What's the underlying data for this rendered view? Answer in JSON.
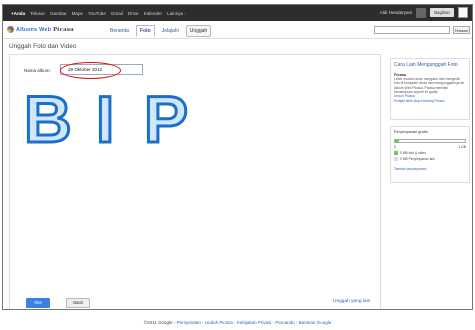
{
  "gbar": {
    "links": [
      "+Anda",
      "Telusur",
      "Gambar",
      "Maps",
      "YouTube",
      "Gmail",
      "Drive",
      "Kalender",
      "Lainnya -"
    ],
    "user": "Aldi Hendaryani",
    "signin": "Bagikan"
  },
  "header": {
    "logo_prefix": "Albums Web",
    "logo_name": "Picasa",
    "nav": [
      "Beranda",
      "Foto",
      "Jelajahi",
      "Unggah"
    ],
    "search_button": "Telusuri"
  },
  "page": {
    "title": "Unggah Foto dan Video",
    "album_label": "Nama album:",
    "album_value": "29 Oktober 2012",
    "bip_letters": [
      "B",
      "I",
      "P"
    ],
    "ok_button": "Oke",
    "cancel_button": "Batal",
    "upload_more": "Unggah yang lain"
  },
  "sidebar": {
    "tips_title": "Cara Lain Mengunggah Foto",
    "tips_sub": "Picasa",
    "tips_text": "Lebih mudah untuk mengatur dan mengedit foto di komputer Anda dan mengunggahnya ke Album Web Picasa. Picasa memiliki kemampuan seperti ini gratis.",
    "tips_link1": "Unduh Picasa",
    "tips_link2": "Pelajari lebih lanjut tentang Picasa",
    "storage_label": "Penyimpanan gratis:",
    "storage_min": "0",
    "storage_max": "1 GB",
    "storage_fraction": 0.05,
    "legend": [
      {
        "label": "0 MB foto & video",
        "color": "#66cc66"
      },
      {
        "label": "0 MB Penyimpanan lain",
        "color": "#dddddd"
      }
    ],
    "storage_link": "Tambah penyimpanan"
  },
  "footer": {
    "copyright": "©2011 Google",
    "links": [
      "Persyaratan",
      "Unduh Picasa",
      "Kebijakan Privasi",
      "Pemandu",
      "Bantuan Google"
    ]
  }
}
